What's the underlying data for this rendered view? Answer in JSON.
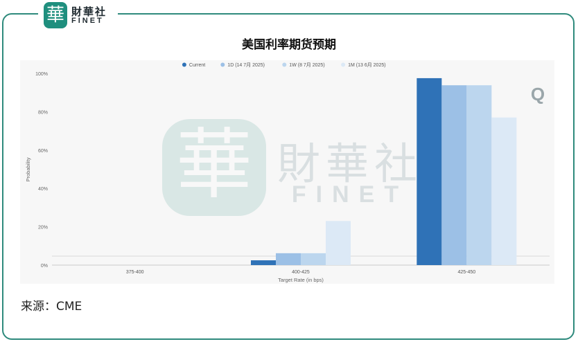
{
  "brand": {
    "logo_char": "華",
    "name_cn": "財華社",
    "name_en": "FINET",
    "watermark_cn": "財華社",
    "watermark_en": "FINET"
  },
  "title": "美国利率期货预期",
  "source": "来源：CME",
  "colors": {
    "frame": "#2e8a7c",
    "series": [
      "#2f72b7",
      "#9cc0e6",
      "#bcd6ee",
      "#dce9f6"
    ]
  },
  "chart_data": {
    "type": "bar",
    "categories": [
      "375-400",
      "400-425",
      "425-450"
    ],
    "series": [
      {
        "name": "Current",
        "values": [
          0,
          2.5,
          97.5
        ]
      },
      {
        "name": "1D (14 7月 2025)",
        "values": [
          0,
          6.2,
          93.8
        ]
      },
      {
        "name": "1W (8 7月 2025)",
        "values": [
          0,
          6.2,
          93.8
        ]
      },
      {
        "name": "1M (13 6月 2025)",
        "values": [
          0,
          23.0,
          77.0
        ]
      }
    ],
    "xlabel": "Target Rate (in bps)",
    "ylabel": "Probability",
    "ylim": [
      0,
      100
    ],
    "yticks": [
      {
        "value": 0,
        "label": "0%"
      },
      {
        "value": 20,
        "label": "20%"
      },
      {
        "value": 40,
        "label": "40%"
      },
      {
        "value": 60,
        "label": "60%"
      },
      {
        "value": 80,
        "label": "80%"
      },
      {
        "value": 100,
        "label": "100%"
      }
    ],
    "legend_position": "top-center",
    "grid": false
  }
}
